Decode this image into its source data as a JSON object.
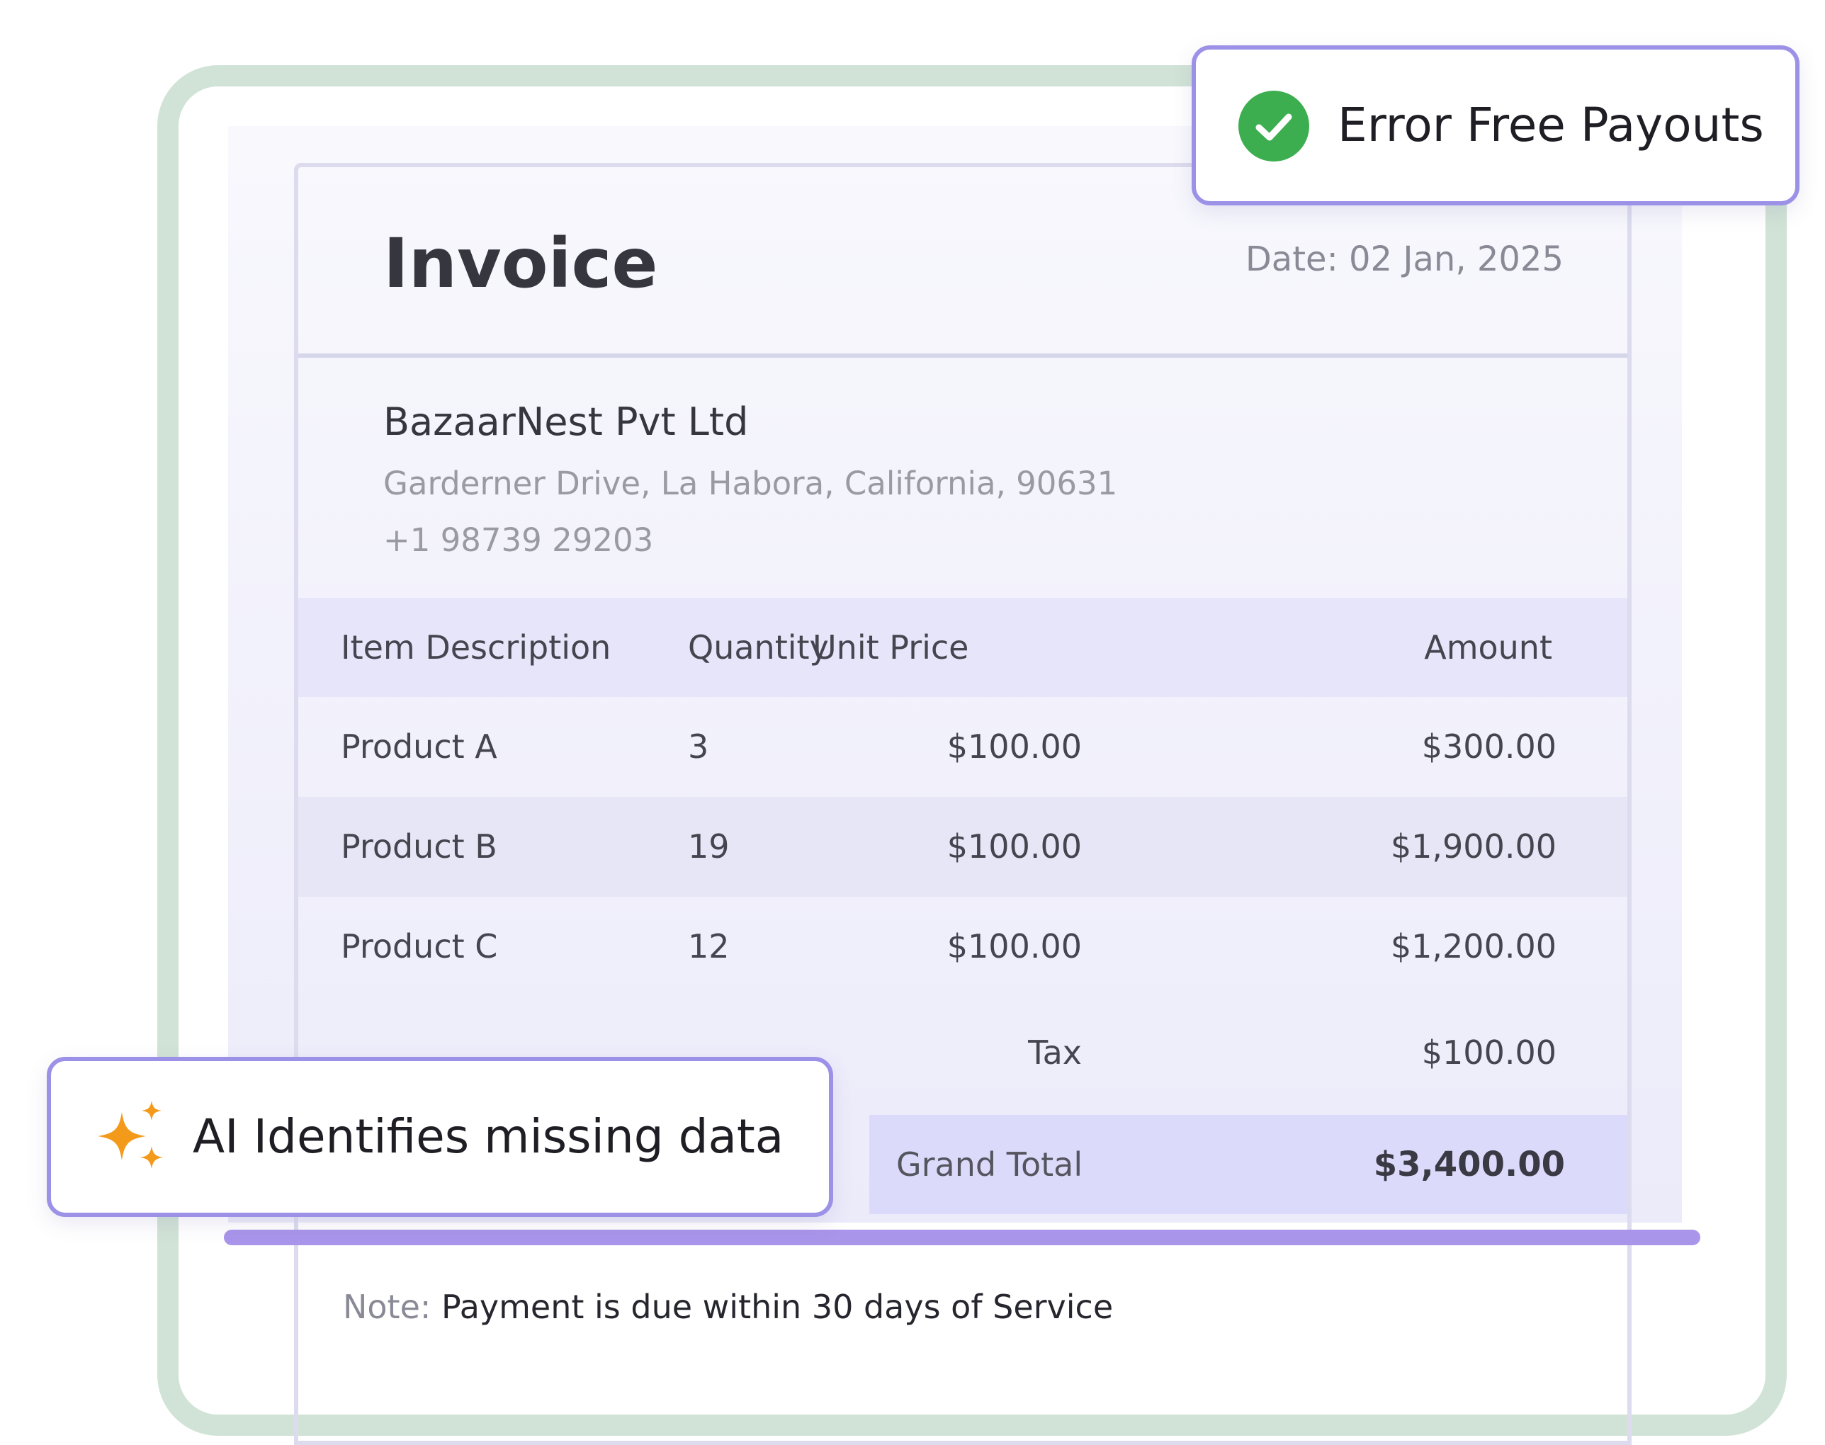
{
  "invoice": {
    "title": "Invoice",
    "date": "Date: 02 Jan, 2025",
    "company": {
      "name": "BazaarNest Pvt Ltd",
      "address": "Garderner Drive, La Habora, California, 90631",
      "phone": "+1 98739 29203"
    },
    "table": {
      "headers": [
        "Item Description",
        "Quantity",
        "Unit Price",
        "Amount"
      ],
      "rows": [
        {
          "description": "Product A",
          "quantity": "3",
          "unit_price": "$100.00",
          "amount": "$300.00"
        },
        {
          "description": "Product B",
          "quantity": "19",
          "unit_price": "$100.00",
          "amount": "$1,900.00"
        },
        {
          "description": "Product C",
          "quantity": "12",
          "unit_price": "$100.00",
          "amount": "$1,200.00"
        }
      ]
    },
    "tax_label": "Tax",
    "tax_value": "$100.00",
    "grand_total_label": "Grand Total",
    "grand_total_value": "$3,400.00",
    "note_label": "Note:",
    "note_text": "Payment is due within 30 days of Service"
  },
  "badges": {
    "payouts": {
      "text": "Error Free Payouts",
      "icon": "check-circle-icon",
      "icon_color": "#3dae4f"
    },
    "ai": {
      "text": "AI Identifies missing data",
      "icon": "sparkle-icon",
      "icon_color": "#f39a1b"
    }
  },
  "colors": {
    "frame": "#d1e3d6",
    "accent_bar": "#a995ea",
    "badge_border": "#9b92e8"
  }
}
